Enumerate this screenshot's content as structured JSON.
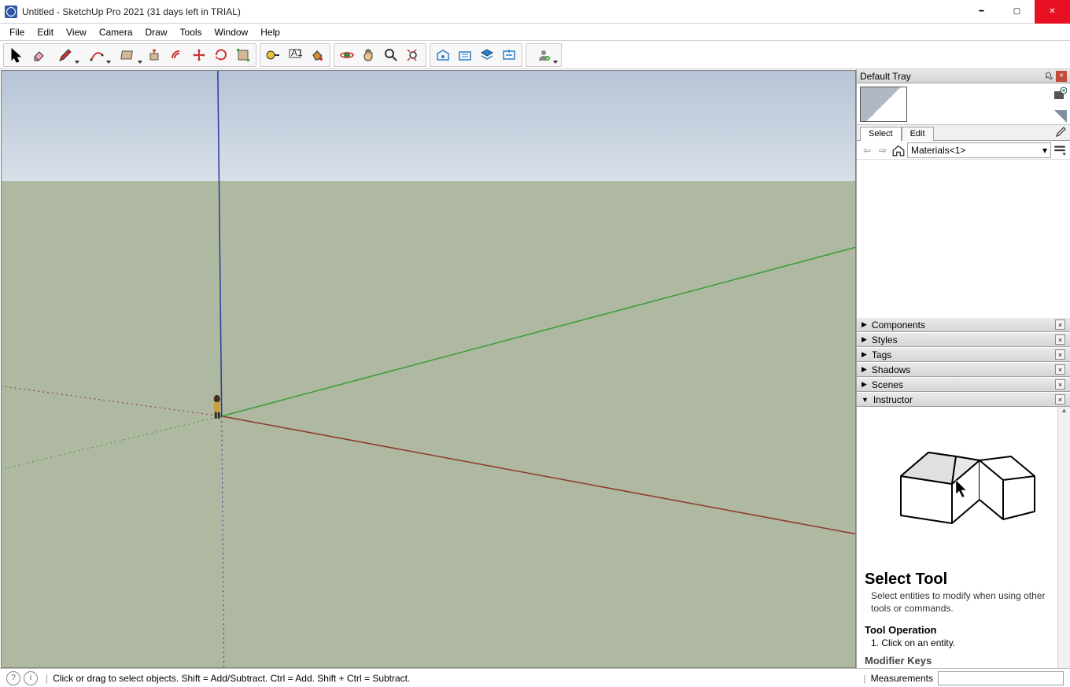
{
  "window": {
    "title": "Untitled - SketchUp Pro 2021 (31 days left in TRIAL)"
  },
  "menu": [
    "File",
    "Edit",
    "View",
    "Camera",
    "Draw",
    "Tools",
    "Window",
    "Help"
  ],
  "toolbar": {
    "groups": [
      [
        {
          "name": "select-tool",
          "kind": "cursor",
          "dd": false
        },
        {
          "name": "eraser-tool",
          "kind": "eraser",
          "dd": false
        },
        {
          "name": "draw-line-tool",
          "kind": "pencil",
          "dd": true
        },
        {
          "name": "draw-arc-tool",
          "kind": "arc",
          "dd": true
        },
        {
          "name": "draw-shape-tool",
          "kind": "rect",
          "dd": true
        },
        {
          "name": "push-pull-tool",
          "kind": "pushpull",
          "dd": false
        },
        {
          "name": "offset-tool",
          "kind": "offset",
          "dd": false
        },
        {
          "name": "move-tool",
          "kind": "move",
          "dd": false
        },
        {
          "name": "rotate-tool",
          "kind": "rotate",
          "dd": false
        },
        {
          "name": "scale-tool",
          "kind": "scale",
          "dd": false
        }
      ],
      [
        {
          "name": "tape-measure-tool",
          "kind": "tape",
          "dd": false
        },
        {
          "name": "text-tool",
          "kind": "text",
          "dd": false
        },
        {
          "name": "paint-bucket-tool",
          "kind": "paint",
          "dd": false
        }
      ],
      [
        {
          "name": "orbit-tool",
          "kind": "orbit",
          "dd": false
        },
        {
          "name": "pan-tool",
          "kind": "pan",
          "dd": false
        },
        {
          "name": "zoom-tool",
          "kind": "zoom",
          "dd": false
        },
        {
          "name": "zoom-extents-tool",
          "kind": "zoomext",
          "dd": false
        }
      ],
      [
        {
          "name": "warehouse-tool",
          "kind": "warehouse",
          "dd": false
        },
        {
          "name": "extension-warehouse-tool",
          "kind": "extwh",
          "dd": false
        },
        {
          "name": "layers-tool",
          "kind": "layers",
          "dd": false
        },
        {
          "name": "extension-manager-tool",
          "kind": "extmgr",
          "dd": false
        }
      ],
      [
        {
          "name": "user-account-tool",
          "kind": "user",
          "dd": true
        }
      ]
    ]
  },
  "tray": {
    "title": "Default Tray",
    "material_tab_select": "Select",
    "material_tab_edit": "Edit",
    "material_dropdown": "Materials<1>",
    "panels": [
      {
        "label": "Components",
        "expanded": false
      },
      {
        "label": "Styles",
        "expanded": false
      },
      {
        "label": "Tags",
        "expanded": false
      },
      {
        "label": "Shadows",
        "expanded": false
      },
      {
        "label": "Scenes",
        "expanded": false
      },
      {
        "label": "Instructor",
        "expanded": true
      }
    ],
    "instructor": {
      "title": "Select Tool",
      "desc": "Select entities to modify when using other tools or commands.",
      "op_header": "Tool Operation",
      "op_step": "1. Click on an entity.",
      "mod_header": "Modifier Keys"
    }
  },
  "status": {
    "hint": "Click or drag to select objects. Shift = Add/Subtract. Ctrl = Add. Shift + Ctrl = Subtract.",
    "measurements_label": "Measurements"
  }
}
